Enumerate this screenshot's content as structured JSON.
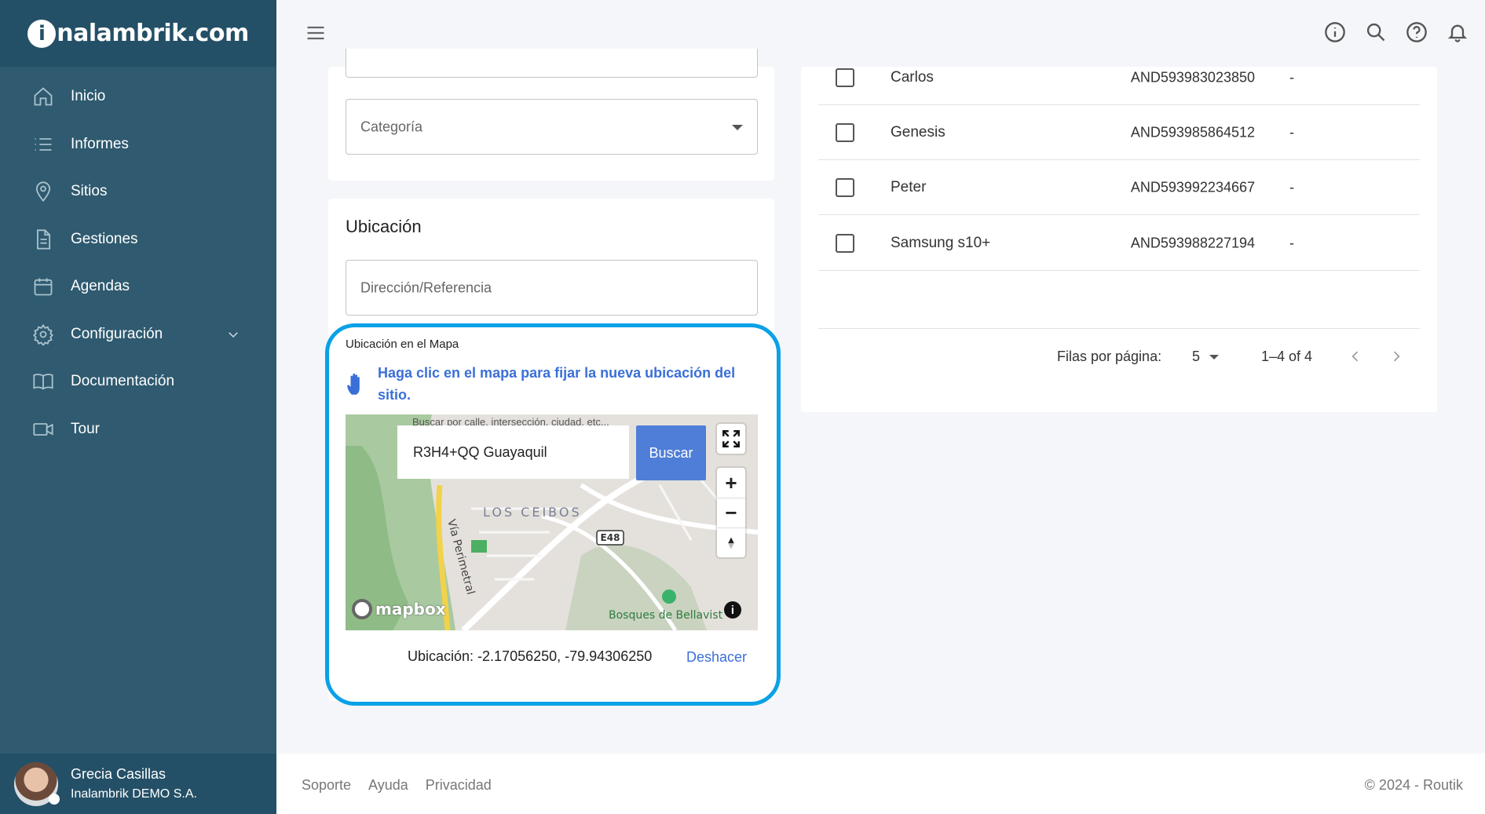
{
  "brand": {
    "logo_text": "nalambrik.com",
    "logo_i": "i"
  },
  "sidebar": {
    "items": [
      {
        "label": "Inicio",
        "icon": "home-icon"
      },
      {
        "label": "Informes",
        "icon": "list-icon"
      },
      {
        "label": "Sitios",
        "icon": "location-pin-icon"
      },
      {
        "label": "Gestiones",
        "icon": "document-icon"
      },
      {
        "label": "Agendas",
        "icon": "calendar-icon"
      },
      {
        "label": "Configuración",
        "icon": "gear-icon"
      },
      {
        "label": "Documentación",
        "icon": "book-icon"
      },
      {
        "label": "Tour",
        "icon": "video-camera-icon"
      }
    ]
  },
  "user": {
    "name": "Grecia Casillas",
    "company": "Inalambrik DEMO S.A."
  },
  "form": {
    "category_placeholder": "Categoría",
    "location_title": "Ubicación",
    "address_placeholder": "Dirección/Referencia"
  },
  "map_section": {
    "label": "Ubicación en el Mapa",
    "hint": "Haga clic en el mapa para fijar la nueva ubicación del sitio.",
    "search_hint": "Buscar por calle, intersección, ciudad, etc...",
    "search_value": "R3H4+QQ Guayaquil",
    "search_button": "Buscar",
    "map_labels": {
      "neighborhood": "LOS CEIBOS",
      "road": "Vía Perimetral",
      "route": "E48",
      "park": "Bosques de Bellavist",
      "attribution": "mapbox"
    },
    "coordinates": "Ubicación: -2.17056250, -79.94306250",
    "undo": "Deshacer"
  },
  "devices": {
    "rows": [
      {
        "name": "Carlos",
        "id": "AND593983023850",
        "extra": "-"
      },
      {
        "name": "Genesis",
        "id": "AND593985864512",
        "extra": "-"
      },
      {
        "name": "Peter",
        "id": "AND593992234667",
        "extra": "-"
      },
      {
        "name": "Samsung s10+",
        "id": "AND593988227194",
        "extra": "-"
      }
    ],
    "rows_per_page_label": "Filas por página:",
    "rows_per_page": "5",
    "range": "1–4 of 4"
  },
  "footer": {
    "links": [
      "Soporte",
      "Ayuda",
      "Privacidad"
    ],
    "copyright": "© 2024 - Routik"
  },
  "colors": {
    "sidebar": "#2f5a6f",
    "sidebar_dark": "#245067",
    "accent": "#3a6fd8",
    "highlight": "#0aa1e6",
    "button": "#4f7ed8"
  }
}
